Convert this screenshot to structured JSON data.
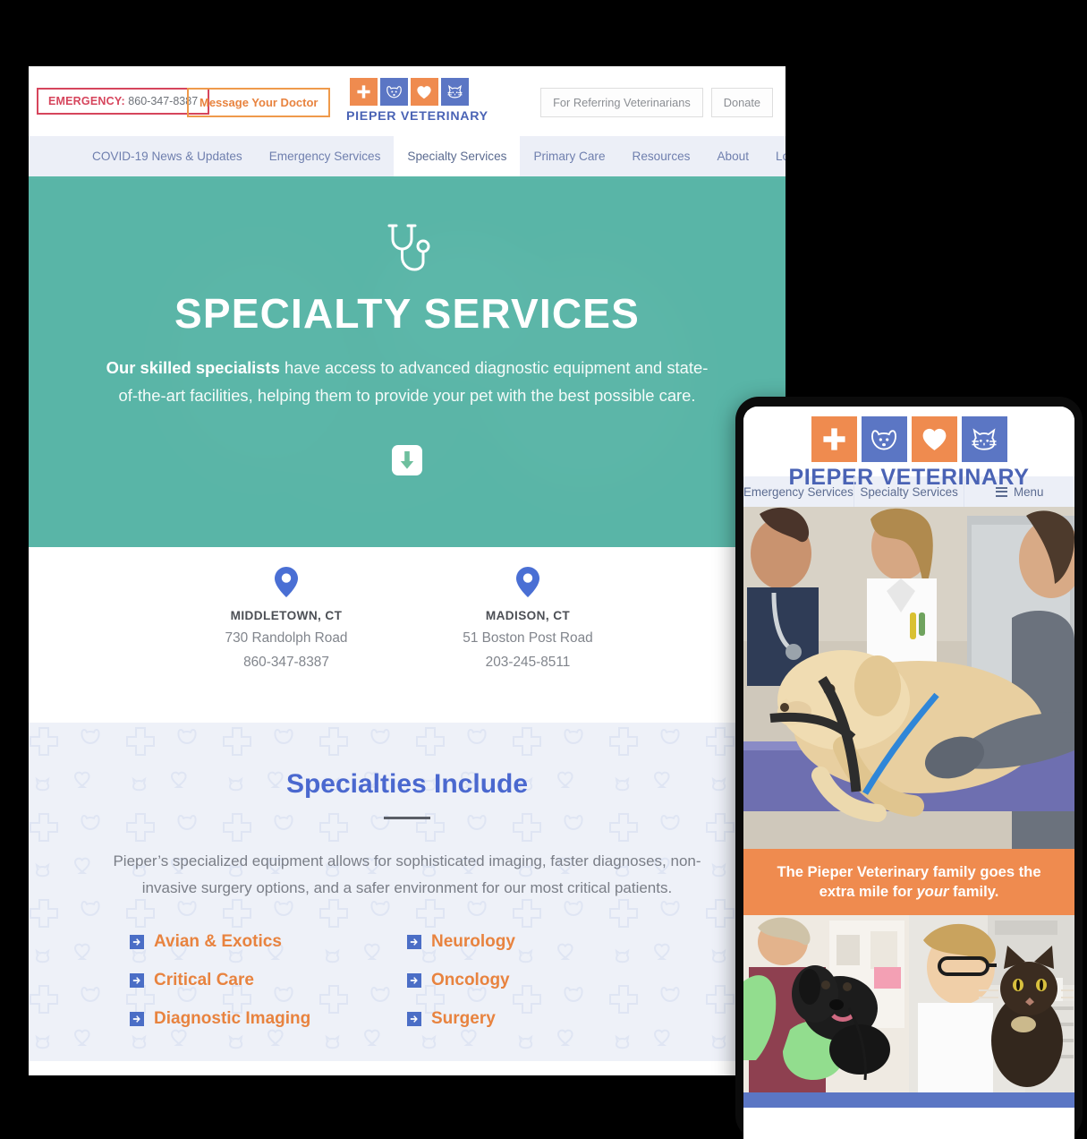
{
  "desktop": {
    "topbar": {
      "emergency_label": "EMERGENCY:",
      "emergency_phone": "860-347-8387",
      "message_doctor": "Message Your Doctor",
      "referring_button": "For Referring Veterinarians",
      "donate_button": "Donate"
    },
    "logo": {
      "wordmark": "PIEPER VETERINARY",
      "tiles": [
        "cross-icon",
        "dog-icon",
        "heart-icon",
        "cat-icon"
      ]
    },
    "nav": {
      "items": [
        {
          "label": "COVID-19 News & Updates",
          "active": false
        },
        {
          "label": "Emergency Services",
          "active": false
        },
        {
          "label": "Specialty Services",
          "active": true
        },
        {
          "label": "Primary Care",
          "active": false
        },
        {
          "label": "Resources",
          "active": false
        },
        {
          "label": "About",
          "active": false
        },
        {
          "label": "Locations",
          "active": false
        }
      ]
    },
    "hero": {
      "icon": "stethoscope-icon",
      "title": "SPECIALTY SERVICES",
      "lead_bold": "Our skilled specialists",
      "lead_rest": " have access to advanced diagnostic equipment and state-of-the-art facilities, helping them to provide your pet with the best possible care.",
      "scroll_icon": "arrow-down-icon",
      "background_color": "#5bb7a8"
    },
    "locations": [
      {
        "city": "MIDDLETOWN, CT",
        "address": "730 Randolph Road",
        "phone": "860-347-8387",
        "icon": "map-pin-icon"
      },
      {
        "city": "MADISON, CT",
        "address": "51 Boston Post Road",
        "phone": "203-245-8511",
        "icon": "map-pin-icon"
      }
    ],
    "specialties": {
      "heading": "Specialties Include",
      "paragraph": "Pieper’s specialized equipment allows for sophisticated imaging, faster diagnoses, non-invasive surgery options, and a safer environment for our most critical patients.",
      "items": [
        "Avian & Exotics",
        "Neurology",
        "Critical Care",
        "Oncology",
        "Diagnostic Imaging",
        "Surgery"
      ],
      "item_icon": "arrow-right-square-icon",
      "heading_color": "#4a68cf",
      "item_color": "#e8833f"
    }
  },
  "mobile": {
    "logo": {
      "wordmark": "PIEPER VETERINARY",
      "tiles": [
        "cross-icon",
        "dog-icon",
        "heart-icon",
        "cat-icon"
      ]
    },
    "nav": {
      "emergency": "Emergency Services",
      "specialty": "Specialty Services",
      "menu": "Menu",
      "menu_icon": "hamburger-icon"
    },
    "hero_photo_alt": "veterinary-team-with-golden-retriever-photo",
    "banner": {
      "line1": "The Pieper Veterinary family goes the",
      "line2_pre": "extra mile for ",
      "line2_em": "your",
      "line2_post": " family."
    },
    "thumbs": [
      {
        "alt": "vet-tech-holding-black-lab-puppy-photo"
      },
      {
        "alt": "veterinarian-holding-tortoiseshell-cat-photo"
      }
    ],
    "footer_color": "#5b76c4"
  },
  "colors": {
    "teal": "#5bb7a8",
    "orange": "#ef8b4f",
    "blue": "#5b76c4",
    "red": "#d6455c",
    "nav_bg": "#eceff7"
  }
}
